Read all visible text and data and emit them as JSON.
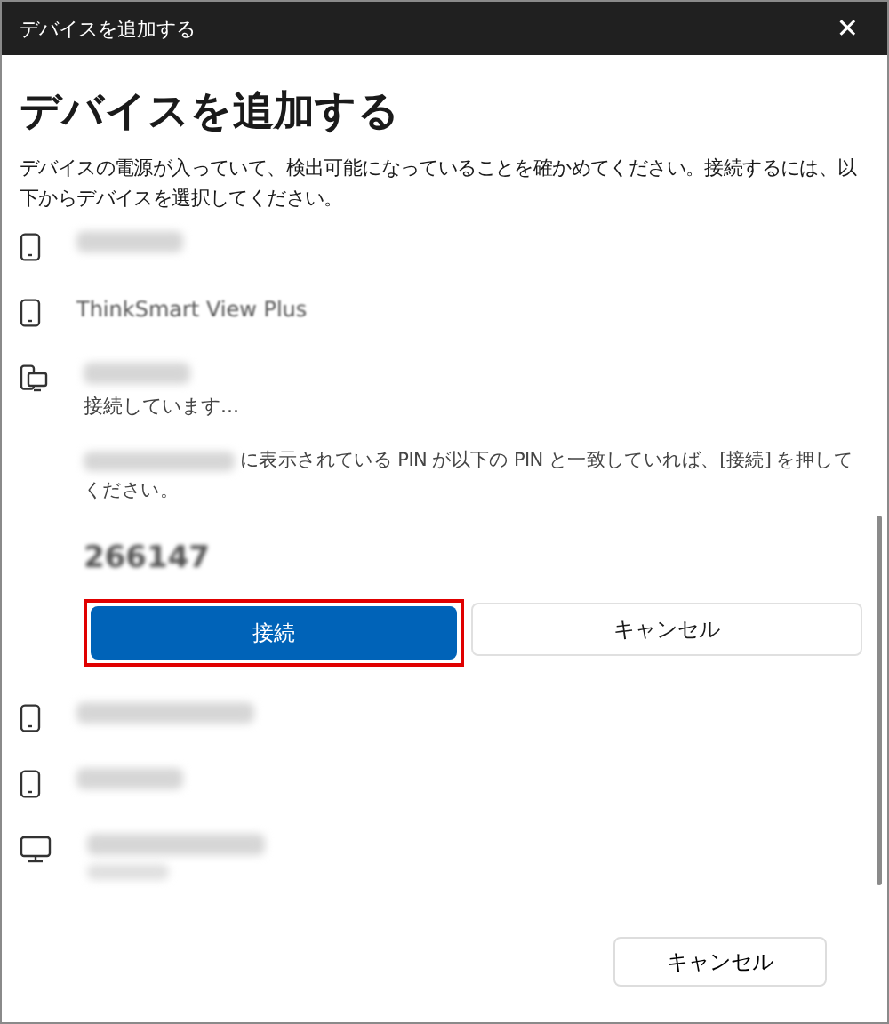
{
  "window": {
    "title": "デバイスを追加する",
    "close": "✕"
  },
  "heading": "デバイスを追加する",
  "description": "デバイスの電源が入っていて、検出可能になっていることを確かめてください。接続するには、以下からデバイスを選択してください。",
  "devices": [
    {
      "kind": "phone",
      "name_blurred": true
    },
    {
      "kind": "phone",
      "name": "ThinkSmart View Plus",
      "name_blurred": false
    },
    {
      "kind": "phone-pc",
      "name_blurred": true,
      "expanded": true,
      "status": "接続しています...",
      "message": "に表示されている PIN が以下の PIN と一致していれば、[接続] を押してください。",
      "pin": "266147",
      "connect_label": "接続",
      "cancel_label": "キャンセル"
    },
    {
      "kind": "phone",
      "name_blurred": true
    },
    {
      "kind": "phone",
      "name_blurred": true
    },
    {
      "kind": "monitor",
      "name_blurred": true,
      "sub_blurred": true
    }
  ],
  "footer": {
    "cancel": "キャンセル"
  }
}
